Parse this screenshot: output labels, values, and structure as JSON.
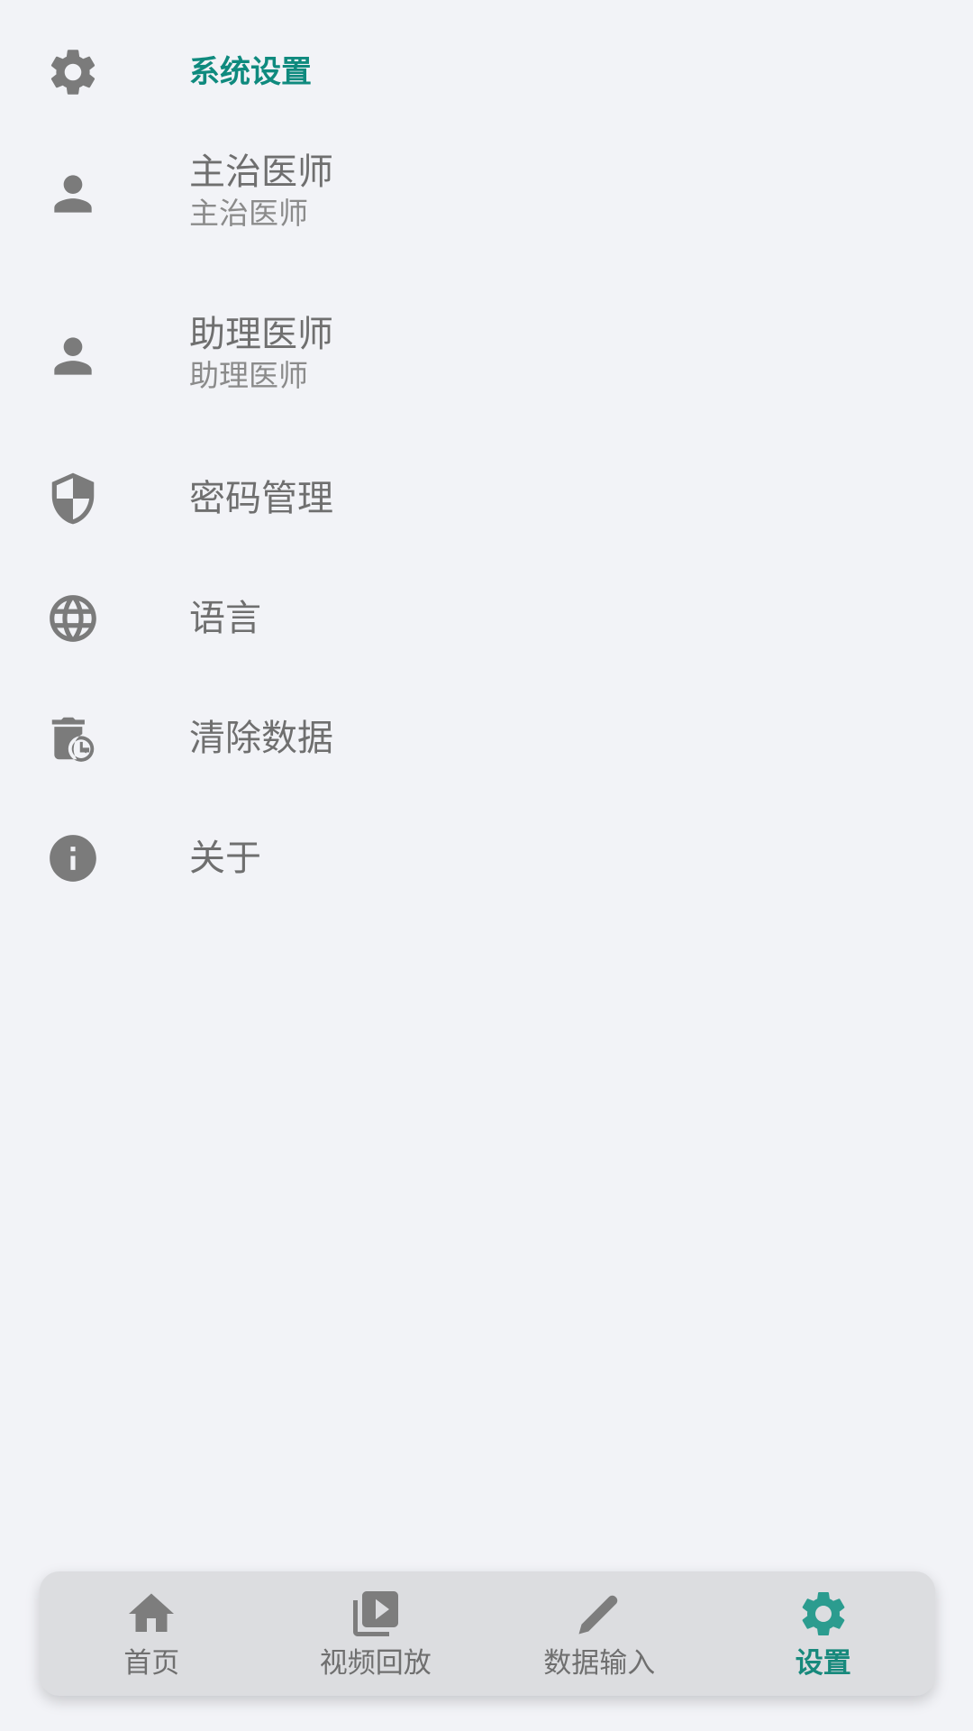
{
  "colors": {
    "background": "#f2f3f7",
    "accent": "#0f8a7e",
    "icon": "#7b7b7b",
    "text": "#6f6f6f",
    "nav_background": "#dcdde0"
  },
  "settings": {
    "header": {
      "label": "系统设置",
      "icon": "gear-icon"
    },
    "items": [
      {
        "title": "主治医师",
        "subtitle": "主治医师",
        "icon": "person-icon"
      },
      {
        "title": "助理医师",
        "subtitle": "助理医师",
        "icon": "person-icon"
      },
      {
        "title": "密码管理",
        "icon": "shield-icon"
      },
      {
        "title": "语言",
        "icon": "globe-icon"
      },
      {
        "title": "清除数据",
        "icon": "delete-clock-icon"
      },
      {
        "title": "关于",
        "icon": "info-icon"
      }
    ]
  },
  "bottom_nav": {
    "active_index": 3,
    "items": [
      {
        "label": "首页",
        "icon": "home-icon"
      },
      {
        "label": "视频回放",
        "icon": "video-library-icon"
      },
      {
        "label": "数据输入",
        "icon": "pencil-icon"
      },
      {
        "label": "设置",
        "icon": "gear-icon"
      }
    ]
  }
}
